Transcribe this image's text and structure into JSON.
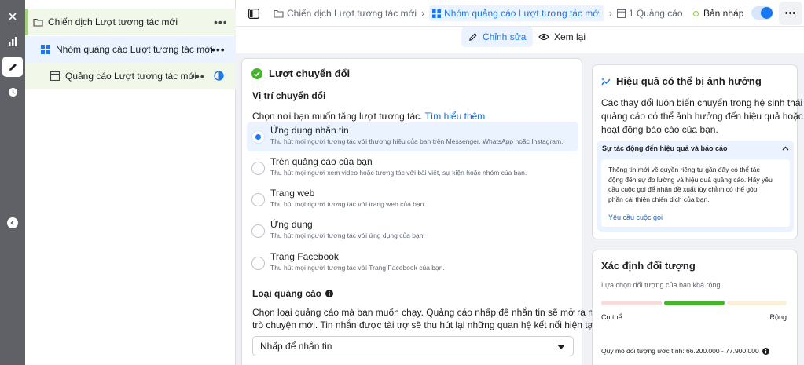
{
  "tree": {
    "campaign": "Chiến dịch Lượt tương tác mới",
    "adset": "Nhóm quảng cáo Lượt tương tác mới",
    "ad": "Quảng cáo Lượt tương tác mới",
    "more": "•••"
  },
  "breadcrumb": {
    "campaign": "Chiến dịch Lượt tương tác mới",
    "adset": "Nhóm quảng cáo Lượt tương tác mới",
    "ad": "1 Quảng cáo",
    "status": "Bản nháp",
    "more": "•••"
  },
  "tabs": {
    "edit": "Chỉnh sửa",
    "review": "Xem lại"
  },
  "conversion": {
    "title": "Lượt chuyển đổi",
    "location_heading": "Vị trí chuyển đổi",
    "location_prompt": "Chọn nơi bạn muốn tăng lượt tương tác.",
    "learn_more": "Tìm hiểu thêm",
    "options": [
      {
        "title": "Ứng dụng nhắn tin",
        "desc": "Thu hút mọi người tương tác với thương hiệu của bạn trên Messenger, WhatsApp hoặc Instagram."
      },
      {
        "title": "Trên quảng cáo của bạn",
        "desc": "Thu hút mọi người xem video hoặc tương tác với bài viết, sự kiện hoặc nhóm của bạn."
      },
      {
        "title": "Trang web",
        "desc": "Thu hút mọi người tương tác với trang web của bạn."
      },
      {
        "title": "Ứng dụng",
        "desc": "Thu hút mọi người tương tác với ứng dụng của bạn."
      },
      {
        "title": "Trang Facebook",
        "desc": "Thu hút mọi người tương tác với Trang Facebook của bạn."
      }
    ],
    "ad_type_heading": "Loại quảng cáo",
    "ad_type_line1": "Chọn loại quảng cáo mà bạn muốn chạy. Quảng cáo nhấp để nhắn tin sẽ mở ra một cuộc",
    "ad_type_line2": "trò chuyện mới. Tin nhắn được tài trợ sẽ thu hút lại những quan hệ kết nối hiện tại.",
    "ad_type_value": "Nhấp để nhắn tin"
  },
  "performance": {
    "title": "Hiệu quả có thể bị ảnh hưởng",
    "body_line1": "Các thay đổi luôn biến chuyển trong hệ sinh thái",
    "body_line2": "quảng cáo có thể ảnh hưởng đến hiệu quả hoặc",
    "body_line3": "hoạt động báo cáo của bạn.",
    "section_title": "Sự tác động đến hiệu quả và báo cáo",
    "detail_line1": "Thông tin mới về quyền riêng tư gần đây có thể tác",
    "detail_line2": "động đến sự đo lường và hiệu quả quảng cáo. Hãy yêu",
    "detail_line3": "cầu cuộc gọi để nhận đề xuất tùy chỉnh có thể góp",
    "detail_line4": "phần cải thiện chiến dịch của bạn.",
    "link": "Yêu cầu cuộc gọi"
  },
  "audience": {
    "title": "Xác định đối tượng",
    "subtitle": "Lựa chọn đối tượng của bạn khá rộng.",
    "left_label": "Cụ thể",
    "right_label": "Rộng",
    "size_text": "Quy mô đối tượng ước tính: 66.200.000 - 77.900.000"
  },
  "colors": {
    "accent": "#1877f2",
    "green": "#42b72a",
    "draft": "#8bc34a"
  }
}
